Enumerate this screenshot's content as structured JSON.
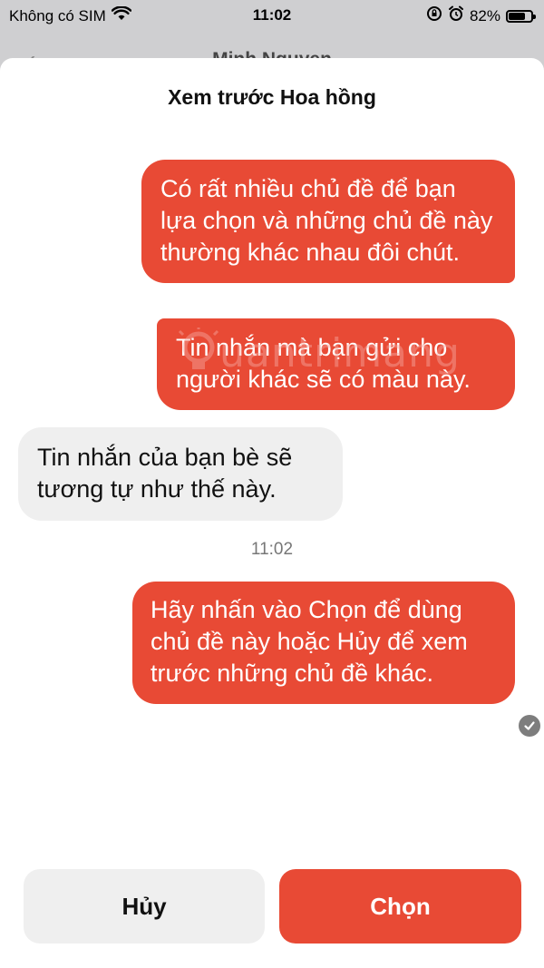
{
  "status_bar": {
    "carrier": "Không có SIM",
    "time": "11:02",
    "battery": "82%",
    "battery_level": 0.82
  },
  "background_nav": {
    "title": "Minh Nguyen"
  },
  "sheet": {
    "title": "Xem trước Hoa hồng"
  },
  "messages": [
    {
      "direction": "out",
      "text": "Có rất nhiều chủ đề để bạn lựa chọn và những chủ đề này thường khác nhau đôi chút."
    },
    {
      "direction": "out",
      "text": "Tin nhắn mà bạn gửi cho người khác sẽ có màu này."
    },
    {
      "direction": "in",
      "text": "Tin nhắn của bạn bè sẽ tương tự như thế này."
    },
    {
      "direction": "out",
      "text": "Hãy nhấn vào Chọn để dùng chủ đề này hoặc Hủy để xem trước những chủ đề khác."
    }
  ],
  "timestamp": "11:02",
  "watermark": "uantrimang",
  "buttons": {
    "cancel": "Hủy",
    "select": "Chọn"
  },
  "colors": {
    "accent": "#e84a35",
    "incoming_bubble": "#efefef",
    "delivered_check": "#7d7d7d"
  }
}
